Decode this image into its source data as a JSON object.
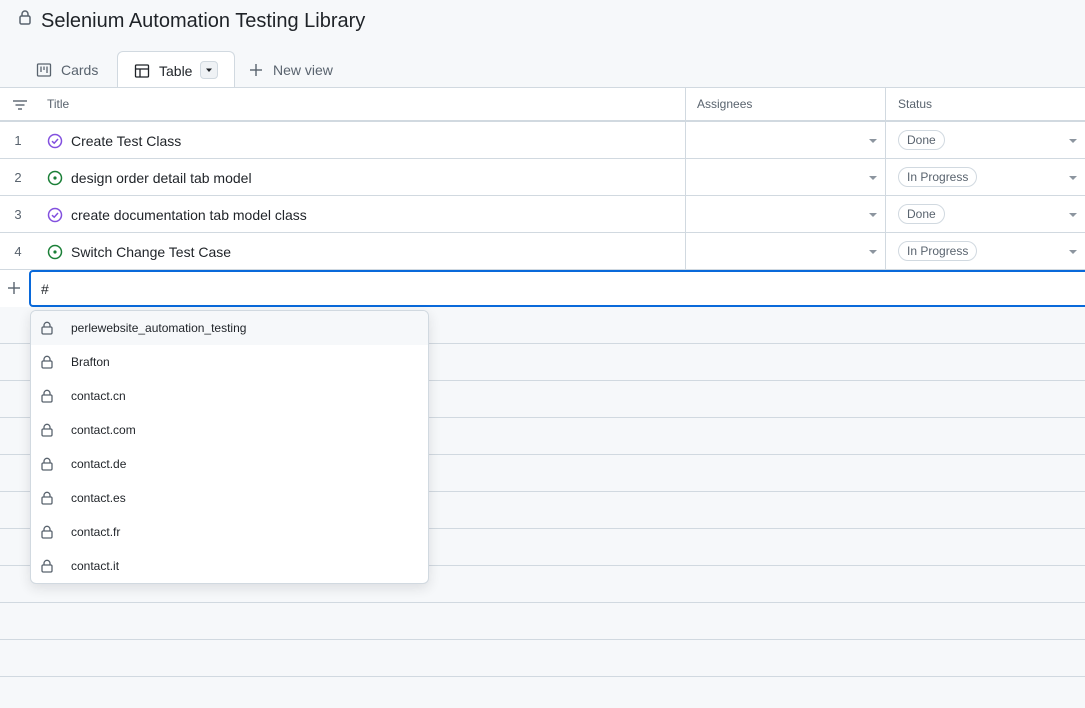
{
  "page": {
    "title": "Selenium Automation Testing Library"
  },
  "tabs": [
    {
      "label": "Cards",
      "icon": "kanban-board-icon"
    },
    {
      "label": "Table",
      "icon": "table-icon"
    },
    {
      "label": "New view",
      "icon": "plus-icon"
    }
  ],
  "columns": {
    "title": "Title",
    "assignees": "Assignees",
    "status": "Status"
  },
  "rows": [
    {
      "num": "1",
      "title": "Create Test Class",
      "state": "closed",
      "status": "Done"
    },
    {
      "num": "2",
      "title": "design order detail tab model",
      "state": "open",
      "status": "In Progress"
    },
    {
      "num": "3",
      "title": "create documentation tab model class",
      "state": "closed",
      "status": "Done"
    },
    {
      "num": "4",
      "title": "Switch Change Test Case",
      "state": "open",
      "status": "In Progress"
    }
  ],
  "add_item": {
    "value": "#"
  },
  "suggestions": [
    {
      "label": "perlewebsite_automation_testing"
    },
    {
      "label": "Brafton"
    },
    {
      "label": "contact.cn"
    },
    {
      "label": "contact.com"
    },
    {
      "label": "contact.de"
    },
    {
      "label": "contact.es"
    },
    {
      "label": "contact.fr"
    },
    {
      "label": "contact.it"
    }
  ],
  "colors": {
    "accent": "#0969da",
    "done": "#8250df",
    "open": "#1a7f37",
    "border": "#d1d9e0"
  }
}
